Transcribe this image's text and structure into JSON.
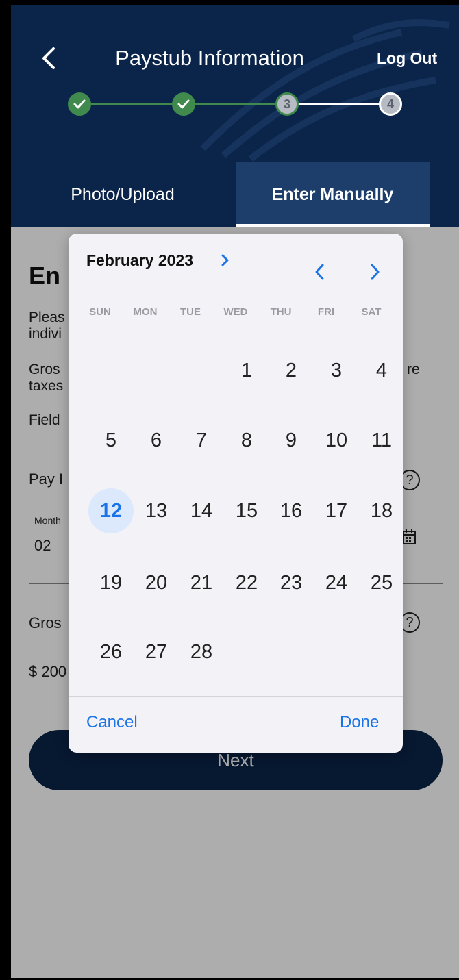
{
  "header": {
    "title": "Paystub Information",
    "logout_label": "Log Out",
    "steps": [
      {
        "label": "",
        "state": "done"
      },
      {
        "label": "",
        "state": "done"
      },
      {
        "label": "3",
        "state": "current"
      },
      {
        "label": "4",
        "state": "todo"
      }
    ]
  },
  "tabs": {
    "photo": "Photo/Upload",
    "manual": "Enter Manually"
  },
  "content": {
    "heading": "En",
    "line1": "Pleas",
    "line2": "indivi",
    "line3": "Gros",
    "line3_right": "re",
    "line4": "taxes",
    "line5": "Field",
    "pay_label": "Pay I",
    "month_label": "Month",
    "month_value": "02",
    "gross_label": "Gros",
    "gross_value": "$ 200",
    "help_glyph": "?",
    "next_label": "Next"
  },
  "datepicker": {
    "month_title": "February 2023",
    "weekdays": [
      "SUN",
      "MON",
      "TUE",
      "WED",
      "THU",
      "FRI",
      "SAT"
    ],
    "weeks": [
      [
        "",
        "",
        "",
        "1",
        "2",
        "3",
        "4"
      ],
      [
        "5",
        "6",
        "7",
        "8",
        "9",
        "10",
        "11"
      ],
      [
        "12",
        "13",
        "14",
        "15",
        "16",
        "17",
        "18"
      ],
      [
        "19",
        "20",
        "21",
        "22",
        "23",
        "24",
        "25"
      ],
      [
        "26",
        "27",
        "28",
        "",
        "",
        "",
        ""
      ]
    ],
    "selected_day": "12",
    "cancel_label": "Cancel",
    "done_label": "Done"
  },
  "colors": {
    "navy": "#0b2449",
    "tab_active": "#1d3d6a",
    "step_done": "#3f8a4c",
    "accent_blue": "#1a73e8"
  },
  "icons": {
    "back": "chevron-left-icon",
    "check": "check-icon",
    "help": "help-circle-icon",
    "calendar": "calendar-icon",
    "month_next": "chevron-right-icon",
    "nav_prev": "chevron-left-icon",
    "nav_next": "chevron-right-icon"
  }
}
